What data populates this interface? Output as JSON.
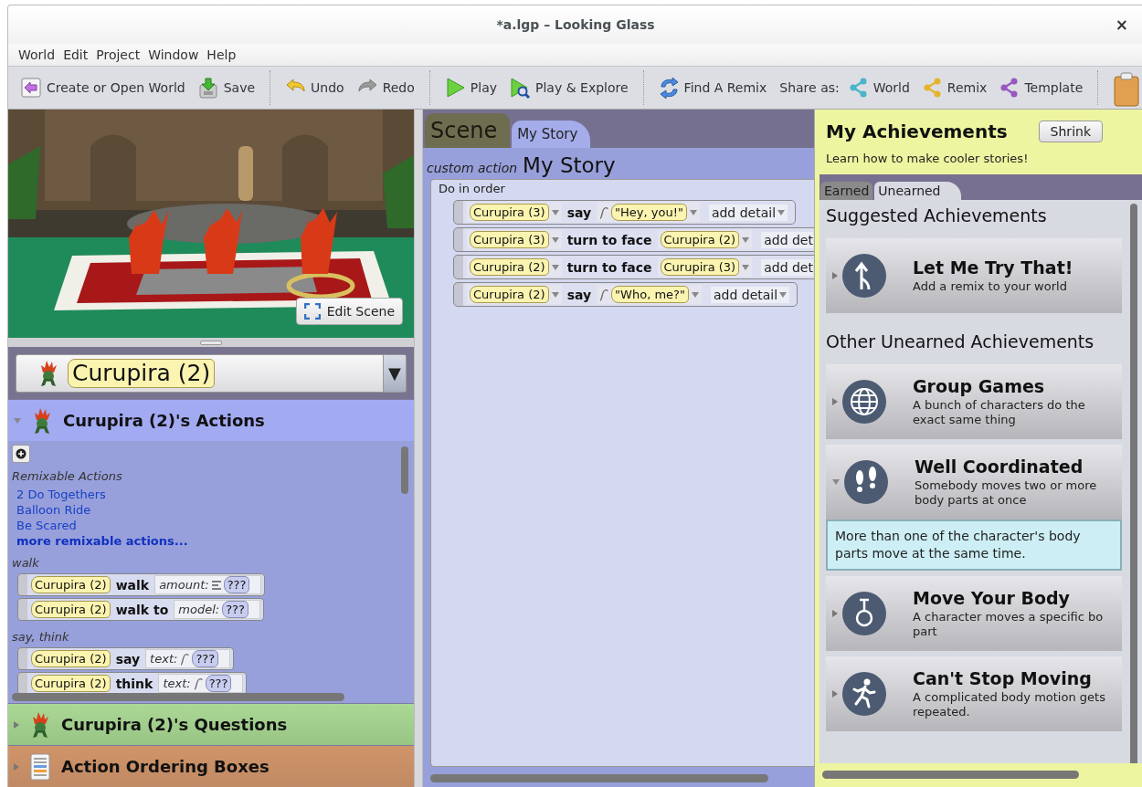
{
  "window": {
    "title": "*a.lgp – Looking Glass",
    "close": "×"
  },
  "menu": [
    {
      "label": "World"
    },
    {
      "label": "Edit"
    },
    {
      "label": "Project"
    },
    {
      "label": "Window"
    },
    {
      "label": "Help"
    }
  ],
  "toolbar": [
    {
      "items": [
        {
          "kind": "button",
          "label": "Create or Open World"
        },
        {
          "kind": "button",
          "label": "Save"
        }
      ]
    },
    {
      "items": [
        {
          "kind": "button",
          "label": "Undo"
        },
        {
          "kind": "button",
          "label": "Redo"
        }
      ]
    },
    {
      "items": [
        {
          "kind": "button",
          "label": "Play"
        },
        {
          "kind": "button",
          "label": "Play & Explore"
        }
      ]
    },
    {
      "items": [
        {
          "kind": "button",
          "label": "Find A Remix"
        },
        {
          "kind": "label",
          "label": "Share as:"
        },
        {
          "kind": "share",
          "label": "World",
          "color": "#4ab4c8"
        },
        {
          "kind": "share",
          "label": "Remix",
          "color": "#e6b42a"
        },
        {
          "kind": "share",
          "label": "Template",
          "color": "#9858c0"
        }
      ]
    },
    {
      "items": [
        {
          "kind": "icon"
        }
      ]
    }
  ],
  "scene": {
    "edit_button": "Edit Scene"
  },
  "selector": {
    "value": "Curupira (2)",
    "arrow": "▼"
  },
  "sections": [
    {
      "kind": "actions",
      "title": "Curupira (2)'s Actions",
      "expanded": true,
      "remixable": {
        "heading": "Remixable Actions",
        "links": [
          "2 Do Togethers",
          "Balloon Ride",
          "Be Scared"
        ],
        "more": "more remixable actions..."
      },
      "groups": [
        {
          "heading": "walk",
          "tiles": [
            {
              "subject": "Curupira (2)",
              "verb": "walk",
              "param": "amount:",
              "kind": "number",
              "value": "???"
            },
            {
              "subject": "Curupira (2)",
              "verb": "walk to",
              "param": "model:",
              "kind": "model",
              "value": "???"
            }
          ]
        },
        {
          "heading": "say, think",
          "tiles": [
            {
              "subject": "Curupira (2)",
              "verb": "say",
              "param": "text:",
              "kind": "text",
              "value": "???"
            },
            {
              "subject": "Curupira (2)",
              "verb": "think",
              "param": "text:",
              "kind": "text",
              "value": "???"
            }
          ]
        }
      ]
    },
    {
      "kind": "questions",
      "title": "Curupira (2)'s Questions",
      "expanded": false
    },
    {
      "kind": "ordering",
      "title": "Action Ordering Boxes",
      "expanded": false
    }
  ],
  "editor": {
    "tabs": [
      {
        "kind": "scene",
        "label": "Scene",
        "selected": false
      },
      {
        "kind": "method",
        "label": "My Story",
        "selected": true
      }
    ],
    "header": {
      "label": "custom action",
      "name": "My Story"
    },
    "block": {
      "label": "Do in order",
      "statements": [
        {
          "subject": "Curupira (3)",
          "verb": "say",
          "kind": "text",
          "arg": "\"Hey, you!\"",
          "detail": "add detail"
        },
        {
          "subject": "Curupira (3)",
          "verb": "turn to face",
          "kind": "model",
          "arg": "Curupira (2)",
          "detail": "add det",
          "cut_off": true
        },
        {
          "subject": "Curupira (2)",
          "verb": "turn to face",
          "kind": "model",
          "arg": "Curupira (3)",
          "detail": "add det",
          "cut_off": true
        },
        {
          "subject": "Curupira (2)",
          "verb": "say",
          "kind": "text",
          "arg": "\"Who, me?\"",
          "detail": "add detail"
        }
      ]
    }
  },
  "achievements": {
    "title": "My Achievements",
    "shrink": "Shrink",
    "subtitle": "Learn how to make cooler stories!",
    "tabs": [
      {
        "label": "Earned",
        "selected": false
      },
      {
        "label": "Unearned",
        "selected": true
      }
    ],
    "groups": [
      {
        "heading": "Suggested Achievements",
        "items": [
          {
            "title": "Let Me Try That!",
            "description": [
              "Add a remix to your world"
            ],
            "expanded": false
          }
        ]
      },
      {
        "heading": "Other Unearned Achievements",
        "items": [
          {
            "title": "Group Games",
            "description": [
              "A bunch of characters do the",
              "exact same thing"
            ],
            "expanded": false
          },
          {
            "title": "Well Coordinated",
            "description": [
              "Somebody moves two or more",
              "body parts at once"
            ],
            "expanded": true,
            "detail": "More than one of the character's body parts move at the same time."
          },
          {
            "title": "Move Your Body",
            "description": [
              "A character moves a specific bo",
              "part"
            ],
            "expanded": false
          },
          {
            "title": "Can't Stop Moving",
            "description": [
              "A complicated body motion gets",
              "repeated."
            ],
            "expanded": false
          }
        ]
      }
    ]
  }
}
